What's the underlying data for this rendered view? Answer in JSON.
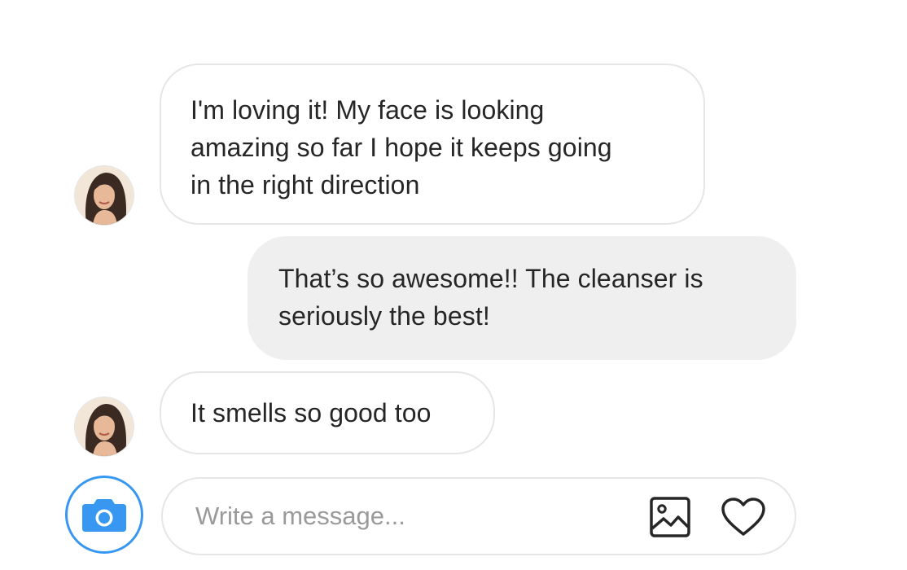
{
  "conversation": {
    "messages": [
      {
        "direction": "incoming",
        "lines": [
          "I'm loving it! My face is looking",
          "amazing so far I hope it keeps going",
          "in the right direction"
        ]
      },
      {
        "direction": "outgoing",
        "lines": [
          "That’s so awesome!! The cleanser is",
          "seriously the best!"
        ]
      },
      {
        "direction": "incoming",
        "lines": [
          "It smells so good too"
        ]
      }
    ]
  },
  "composer": {
    "placeholder": "Write a message...",
    "value": "",
    "icons": {
      "camera": "camera-icon",
      "gallery": "image-icon",
      "like": "heart-icon"
    }
  },
  "colors": {
    "accent": "#3897f0",
    "bubble_outgoing": "#efefef",
    "bubble_border": "#e6e6e6",
    "text": "#262626",
    "placeholder": "#9a9a9a"
  }
}
